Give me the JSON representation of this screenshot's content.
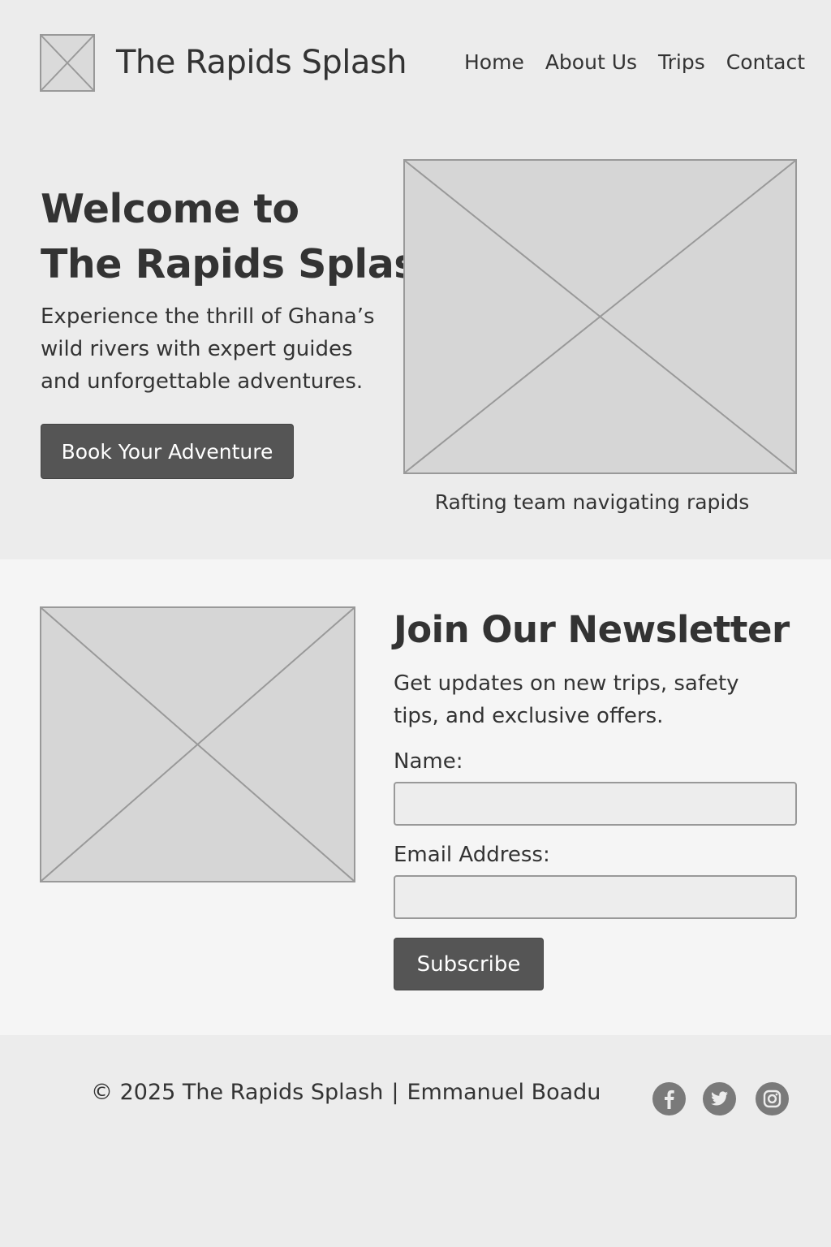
{
  "header": {
    "logo_icon": "image-placeholder-icon",
    "title": "The Rapids Splash",
    "nav": [
      {
        "label": "Home"
      },
      {
        "label": "About Us"
      },
      {
        "label": "Trips"
      },
      {
        "label": "Contact"
      }
    ]
  },
  "hero": {
    "title_line1": "Welcome to",
    "title_line2": "The Rapids Splash",
    "description": "Experience the thrill of Ghana’s wild rivers with expert guides and unforgettable adventures.",
    "cta_label": "Book Your Adventure",
    "image_icon": "image-placeholder-icon",
    "image_caption": "Rafting team navigating rapids"
  },
  "newsletter": {
    "image_icon": "image-placeholder-icon",
    "title": "Join Our Newsletter",
    "description": "Get updates on new trips, safety tips, and exclusive offers.",
    "name_label": "Name:",
    "name_value": "",
    "email_label": "Email Address:",
    "email_value": "",
    "submit_label": "Subscribe"
  },
  "footer": {
    "copyright": "© 2025 The Rapids Splash",
    "separator": "|",
    "author": "Emmanuel Boadu",
    "social": [
      {
        "icon": "facebook-icon"
      },
      {
        "icon": "twitter-icon"
      },
      {
        "icon": "instagram-icon"
      }
    ]
  },
  "colors": {
    "background": "#ececec",
    "section_alt": "#f5f5f5",
    "text": "#333333",
    "button": "#555555",
    "placeholder_fill": "#d6d6d6",
    "placeholder_stroke": "#999999",
    "social_icon": "#7a7a7a"
  }
}
